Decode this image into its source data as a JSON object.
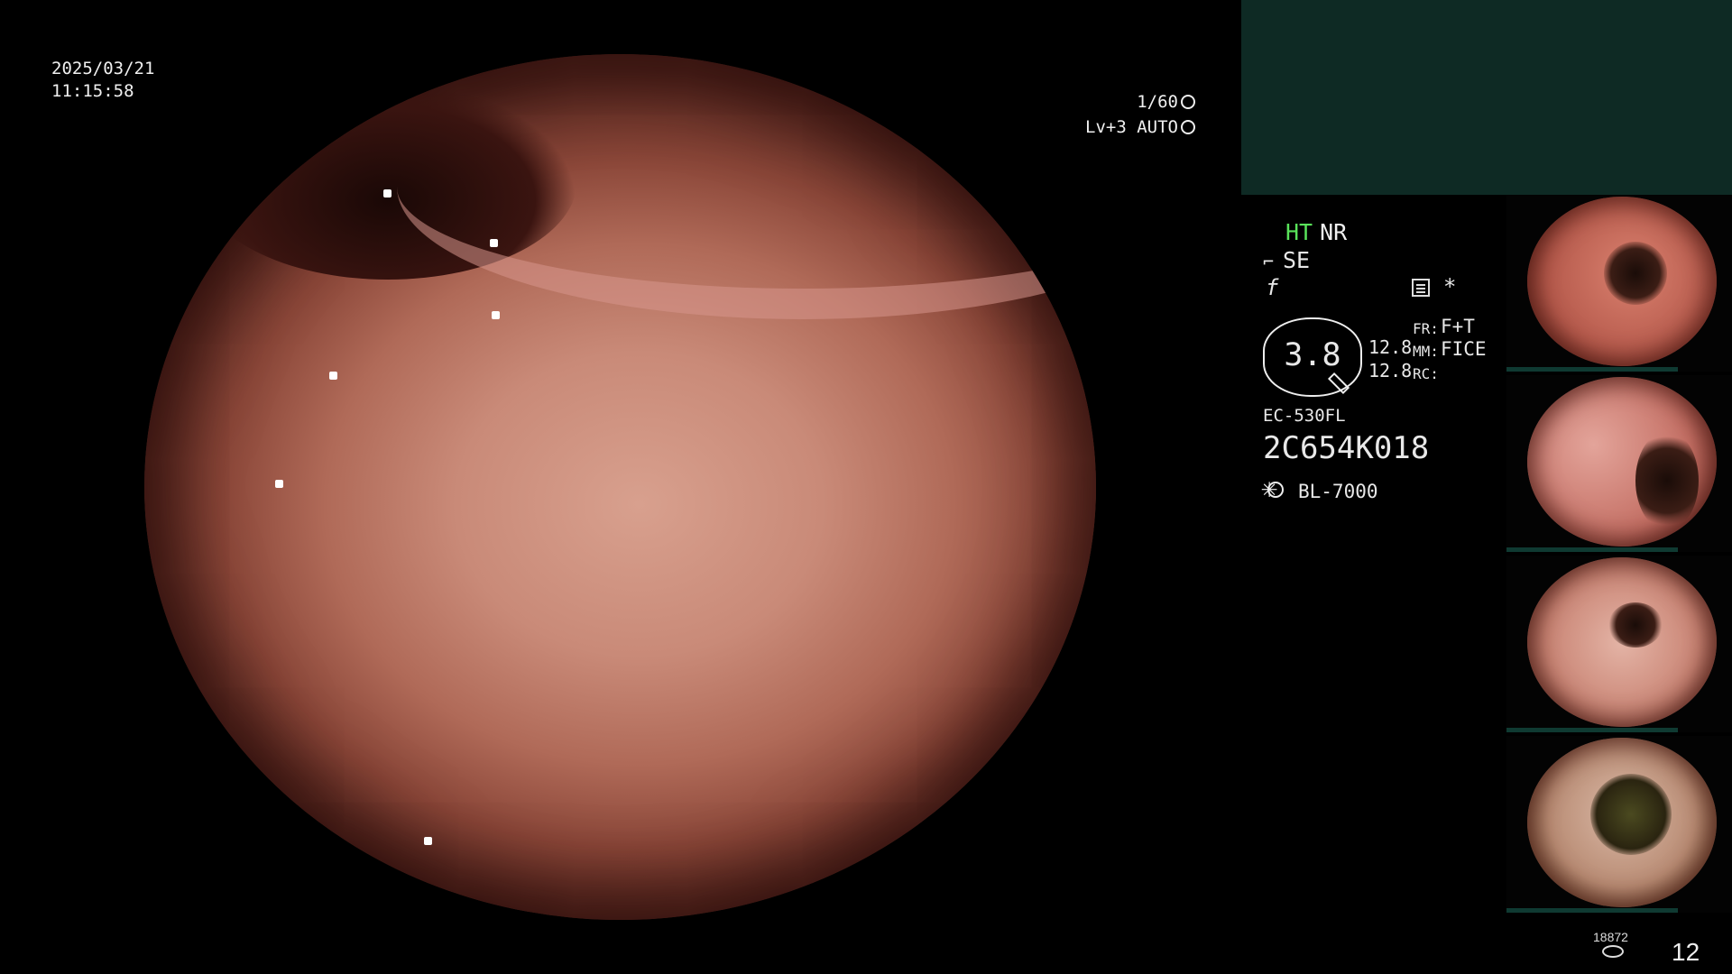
{
  "overlay": {
    "date": "2025/03/21",
    "time": "11:15:58",
    "shutter": "1/60",
    "level": "Lv+3 AUTO"
  },
  "panel": {
    "mode_ht": "HT",
    "mode_nr": "NR",
    "se_label": "SE",
    "f_symbol": "f",
    "star": "*",
    "zoom_value": "3.8",
    "num_top": "12.8",
    "num_bottom": "12.8",
    "fr_label": "FR:",
    "fr_value": "F+T",
    "mm_label": "MM:",
    "mm_value": "FICE",
    "rc_label": "RC:",
    "scope_model": "EC-530FL",
    "serial": "2C654K018",
    "light_source": "BL-7000"
  },
  "footer": {
    "counter": "18872",
    "page": "12"
  },
  "colors": {
    "ht_green": "#59e35a",
    "panel_teal": "#0e2a24"
  }
}
